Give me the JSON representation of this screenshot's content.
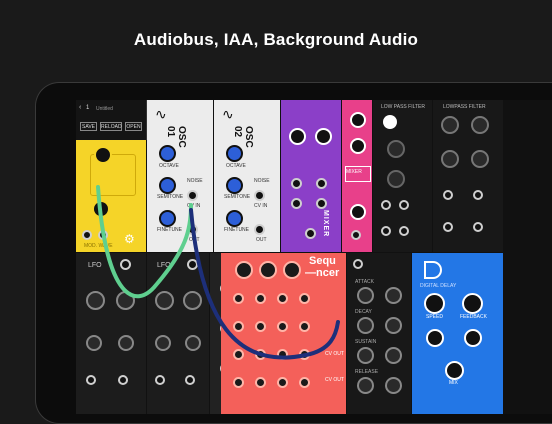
{
  "headline": "Audiobus, IAA, Background Audio",
  "toolbar": {
    "preset_number": "1",
    "preset_name": "Untitled",
    "save_label": "SAVE",
    "reload_label": "RELOAD",
    "open_label": "OPEN"
  },
  "modules": {
    "fx": {
      "label": "MOD. WAVE"
    },
    "osc1": {
      "title": "OSC 01",
      "octave": "OCTAVE",
      "semitone": "SEMITONE",
      "finetune": "FINETUNE",
      "cvin": "CV IN",
      "noise": "NOISE",
      "out": "OUT"
    },
    "osc2": {
      "title": "OSC 02",
      "octave": "OCTAVE",
      "semitone": "SEMITONE",
      "finetune": "FINETUNE",
      "cvin": "CV IN",
      "noise": "NOISE",
      "out": "OUT"
    },
    "mixer": {
      "title": "MIXER"
    },
    "mix2": {
      "title": "MIXER"
    },
    "lowpass1": {
      "title": "LOW PASS FILTER"
    },
    "lowpass2": {
      "title": "LOWPASS FILTER"
    },
    "lfo1": {
      "title": "LFO"
    },
    "lfo2": {
      "title": "LFO"
    },
    "sequencer": {
      "title_line1": "Sequ",
      "title_line2": "—ncer",
      "cv_out": "CV OUT",
      "trig_out": "CV OUT"
    },
    "adsr": {
      "attack": "ATTACK",
      "decay": "DECAY",
      "sustain": "SUSTAIN",
      "release": "RELEASE"
    },
    "delay": {
      "title": "DIGITAL DELAY",
      "speed": "SPEED",
      "feedback": "FEEDBACK",
      "mix": "MIX"
    }
  },
  "colors": {
    "yellow": "#f5d428",
    "purple": "#8b3fc8",
    "pink": "#e8408a",
    "coral": "#f4605a",
    "blue": "#2377e6",
    "cable_green": "#5fcf8f",
    "cable_navy": "#1d2f7a"
  }
}
